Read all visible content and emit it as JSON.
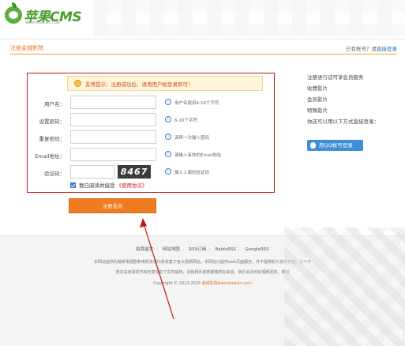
{
  "header": {
    "logo_text": "苹果CMS",
    "logo_sub": "WWW.MACCMS.COM",
    "section_title": "注册金城影院",
    "login_prompt": "已有帐号？请",
    "login_link": "直接登录"
  },
  "notice": "友情提示：注册成功后，请用用户帐登录即可！",
  "form": {
    "fields": [
      {
        "label": "用户名：",
        "value": "",
        "hint": "用户名使用4-16个字符"
      },
      {
        "label": "设置密码：",
        "value": "",
        "hint": "6-16个字符"
      },
      {
        "label": "重复密码：",
        "value": "",
        "hint": "请再一次输入密码"
      },
      {
        "label": "Email地址：",
        "value": "",
        "hint": "请输入有效的Email地址"
      },
      {
        "label": "验证码：",
        "value": "",
        "hint": "输入上面的验证码"
      }
    ],
    "captcha_text": "8467",
    "agree_text": "我已阅读并接受",
    "agree_link": "《使用协议》",
    "submit": "注册会员"
  },
  "sidebar": {
    "items": [
      "注册进行证可享会员服务",
      "收费影片",
      "会员影片",
      "特殊影片",
      "你还可以用以下方式直接登录："
    ],
    "qq_button": "用QQ帐号登录"
  },
  "footer": {
    "nav": [
      "給我留言",
      "网站地图",
      "RSS订阅",
      "BaiduRSS",
      "GoogleRSS"
    ],
    "line1": "本网站提供的最新电视剧和电影资源均系收集于各大视频网站，本网站只提供web页面服务，并不提供影片资源存储，也不参",
    "line2": "若本站收录的节目无意侵犯了贵司版权，请给网页底部邮箱地址来信，我们会及时处理和回复，谢谢",
    "line3_prefix": "Copyright © 2013-2015",
    "line3_link": "金城影院www.bowsin.com"
  },
  "colors": {
    "accent": "#ef7c1e",
    "form_border": "#c21a1a",
    "link": "#1d6fb5",
    "qq_button": "#3f8fd6"
  }
}
